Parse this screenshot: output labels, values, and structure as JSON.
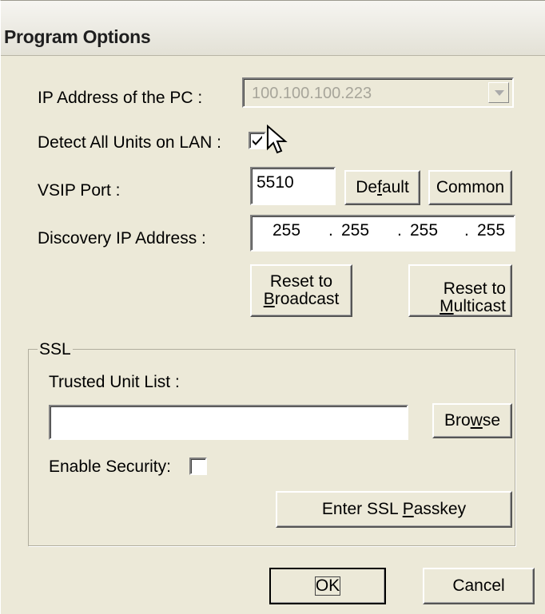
{
  "window": {
    "title": "Program Options"
  },
  "ip": {
    "label": "IP Address of the PC :",
    "value": "100.100.100.223"
  },
  "detect": {
    "label": "Detect All Units on LAN :",
    "checked": true
  },
  "vsip": {
    "label": "VSIP Port :",
    "value": "5510",
    "default_pre": "De",
    "default_key": "f",
    "default_post": "ault",
    "common_label": "Common"
  },
  "discovery": {
    "label": "Discovery IP Address :",
    "octets": [
      "255",
      "255",
      "255",
      "255"
    ],
    "dot": "."
  },
  "reset_broadcast": {
    "line1": "Reset to",
    "key": "B",
    "rest": "roadcast"
  },
  "reset_multicast": {
    "line1": "Reset to",
    "key": "M",
    "rest": "ulticast"
  },
  "ssl": {
    "legend": "SSL",
    "trusted_label": "Trusted Unit List :",
    "trusted_value": "",
    "browse_pre": "Bro",
    "browse_key": "w",
    "browse_post": "se",
    "security_label": "Enable Security:",
    "security_checked": false,
    "passkey_pre": "Enter SSL ",
    "passkey_key": "P",
    "passkey_post": "asskey"
  },
  "footer": {
    "ok": "OK",
    "cancel": "Cancel"
  }
}
